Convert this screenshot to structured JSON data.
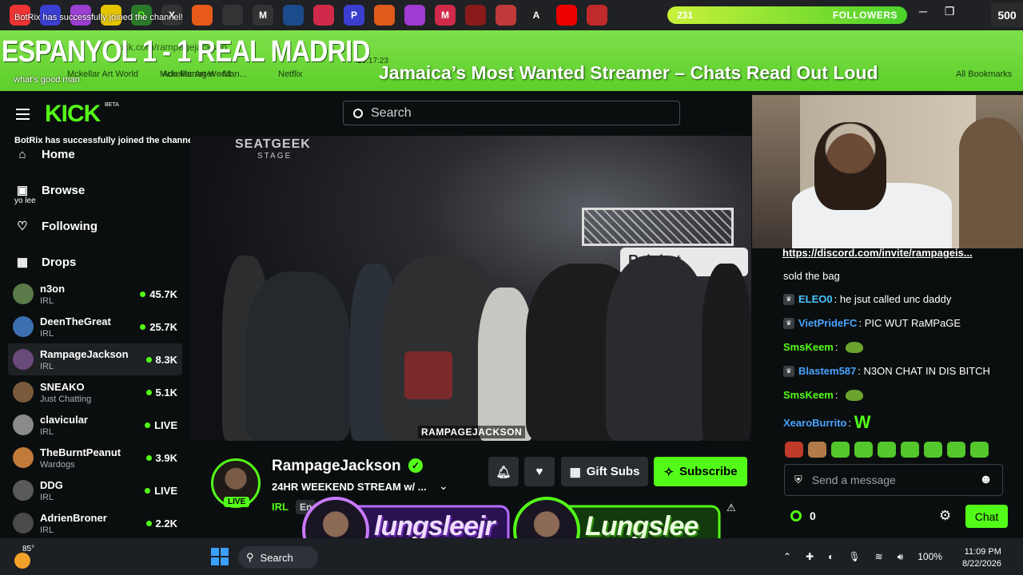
{
  "overlay": {
    "tab_notice": "BotRix has successfully joined the channel!",
    "match_title": "ESPANYOL 1 - 1 REAL MADRID",
    "ticker": "Jamaica’s Most Wanted Streamer – Chats Read Out Loud",
    "chat_greeting": "what's good man",
    "followers_count": "231",
    "followers_label": "FOLLOWERS",
    "counter": "500"
  },
  "browser": {
    "url": "kick.com/rampagejackson",
    "clock": "19:17:23",
    "bookmarks": [
      "Mckellar Art World",
      "Ads Manager - Man...",
      "Netflix",
      "All Bookmarks"
    ]
  },
  "sidebar": {
    "logo": "KICK",
    "beta": "BETA",
    "bot_notice": "BotRix has successfully joined the channel!",
    "yo_lee": "yo lee",
    "nav": [
      {
        "label": "Home",
        "icon": "home-icon"
      },
      {
        "label": "Browse",
        "icon": "browse-icon"
      },
      {
        "label": "Following",
        "icon": "heart-icon"
      },
      {
        "label": "Drops",
        "icon": "drops-icon"
      }
    ],
    "channels": [
      {
        "name": "n3on",
        "category": "IRL",
        "viewers": "45.7K",
        "color": "#5b7a4a"
      },
      {
        "name": "DeenTheGreat",
        "category": "IRL",
        "viewers": "25.7K",
        "color": "#3b6fb0"
      },
      {
        "name": "RampageJackson",
        "category": "IRL",
        "viewers": "8.3K",
        "color": "#6a4a7a"
      },
      {
        "name": "SNEAKO",
        "category": "Just Chatting",
        "viewers": "5.1K",
        "color": "#7a5a3a"
      },
      {
        "name": "clavicular",
        "category": "IRL",
        "viewers": "LIVE",
        "color": "#8a8a8a"
      },
      {
        "name": "TheBurntPeanut",
        "category": "Wardogs",
        "viewers": "3.9K",
        "color": "#c07a3a"
      },
      {
        "name": "DDG",
        "category": "IRL",
        "viewers": "LIVE",
        "color": "#5a5a5a"
      },
      {
        "name": "AdrienBroner",
        "category": "IRL",
        "viewers": "2.2K",
        "color": "#4a4a4a"
      }
    ]
  },
  "search": {
    "placeholder": "Search"
  },
  "video": {
    "stage_sign": "SEATGEEK",
    "stage_sub": "STAGE",
    "banner": "Rainbet",
    "label": "RAMPAGEJACKSON"
  },
  "stream": {
    "name": "RampageJackson",
    "title": "24HR WEEKEND STREAM w/ ...",
    "category": "IRL",
    "language": "En",
    "live": "LIVE",
    "gift_label": "Gift Subs",
    "subscribe_label": "Subscribe"
  },
  "chat": {
    "pinned_link": "https://discord.com/invite/rampageis...",
    "messages": [
      {
        "user": "",
        "text": "sold the bag",
        "color": "#ffffff"
      },
      {
        "user": "ELEO0",
        "text": "he jsut called unc daddy",
        "color": "#49c6ff"
      },
      {
        "user": "VietPrideFC",
        "text": "PIC WUT RaMPaGE",
        "color": "#49a3ff"
      },
      {
        "user": "SmsKeem",
        "text": "",
        "color": "#53fc18"
      },
      {
        "user": "Blastem587",
        "text": "N3ON CHAT IN DIS BITCH",
        "color": "#49a3ff"
      },
      {
        "user": "SmsKeem",
        "text": "",
        "color": "#53fc18"
      },
      {
        "user": "XearoBurrito",
        "text": "W",
        "color": "#49a3ff"
      }
    ],
    "input_placeholder": "Send a message",
    "points": "0",
    "send_label": "Chat"
  },
  "brand": {
    "left": "lungsleejr",
    "right": "Lungslee"
  },
  "taskbar": {
    "weather": "85°",
    "search_label": "Search",
    "battery": "100%",
    "time": "11:09 PM",
    "date": "8/22/2026"
  }
}
